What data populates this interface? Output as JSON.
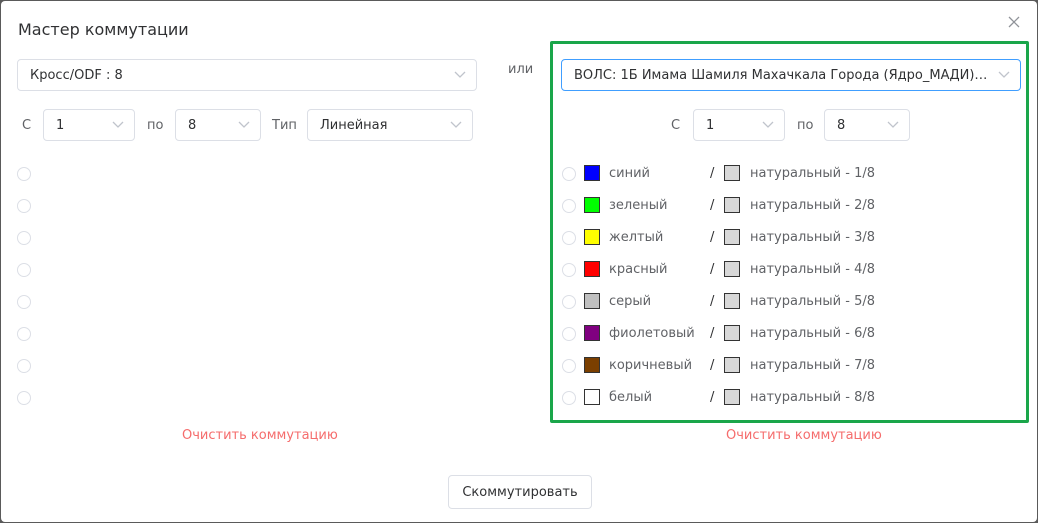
{
  "dialog": {
    "title": "Мастер коммутации",
    "or_label": "или",
    "commutate_button": "Скоммутировать"
  },
  "left": {
    "cross_select": "Кросс/ODF : 8",
    "from_label": "С",
    "from_value": "1",
    "to_label": "по",
    "to_value": "8",
    "type_label": "Тип",
    "type_value": "Линейная",
    "clear_link": "Очистить коммутацию",
    "port_count": 8
  },
  "right": {
    "cable_select": "ВОЛС: 1Б Имама Шамиля Махачкала Города (Ядро_МАДИ) #...",
    "from_label": "С",
    "from_value": "1",
    "to_label": "по",
    "to_value": "8",
    "clear_link": "Очистить коммутацию",
    "highlight_color": "#1aa64a",
    "fibers": [
      {
        "color_name": "синий",
        "color": "#0000ff",
        "module_color": "#d8d8d8",
        "module_name": "натуральный - 1/8"
      },
      {
        "color_name": "зеленый",
        "color": "#00ff00",
        "module_color": "#d8d8d8",
        "module_name": "натуральный - 2/8"
      },
      {
        "color_name": "желтый",
        "color": "#ffff00",
        "module_color": "#d8d8d8",
        "module_name": "натуральный - 3/8"
      },
      {
        "color_name": "красный",
        "color": "#ff0000",
        "module_color": "#d8d8d8",
        "module_name": "натуральный - 4/8"
      },
      {
        "color_name": "серый",
        "color": "#c0c0c0",
        "module_color": "#d8d8d8",
        "module_name": "натуральный - 5/8"
      },
      {
        "color_name": "фиолетовый",
        "color": "#800080",
        "module_color": "#d8d8d8",
        "module_name": "натуральный - 6/8"
      },
      {
        "color_name": "коричневый",
        "color": "#7b3f00",
        "module_color": "#d8d8d8",
        "module_name": "натуральный - 7/8"
      },
      {
        "color_name": "белый",
        "color": "#ffffff",
        "module_color": "#d8d8d8",
        "module_name": "натуральный - 8/8"
      }
    ]
  }
}
